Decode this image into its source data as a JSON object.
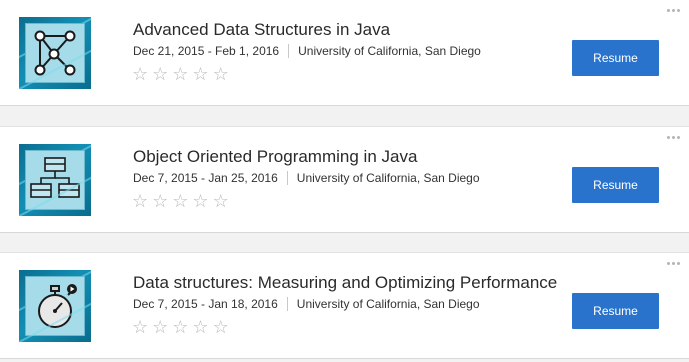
{
  "courses": [
    {
      "title": "Advanced Data Structures in Java",
      "dates": "Dec 21, 2015 - Feb 1, 2016",
      "institution": "University of California, San Diego",
      "icon": "graph-network-icon",
      "rating": 0,
      "resume_label": "Resume"
    },
    {
      "title": "Object Oriented Programming in Java",
      "dates": "Dec 7, 2015 - Jan 25, 2016",
      "institution": "University of California, San Diego",
      "icon": "class-diagram-icon",
      "rating": 0,
      "resume_label": "Resume"
    },
    {
      "title": "Data structures: Measuring and Optimizing Performance",
      "dates": "Dec 7, 2015 - Jan 18, 2016",
      "institution": "University of California, San Diego",
      "icon": "stopwatch-icon",
      "rating": 0,
      "resume_label": "Resume"
    }
  ],
  "colors": {
    "accent": "#2a73cc",
    "thumb_bg": "#138fb4",
    "star_empty": "#b9b9b9"
  },
  "star_glyph": "☆",
  "more_icon": "more-dots-icon"
}
